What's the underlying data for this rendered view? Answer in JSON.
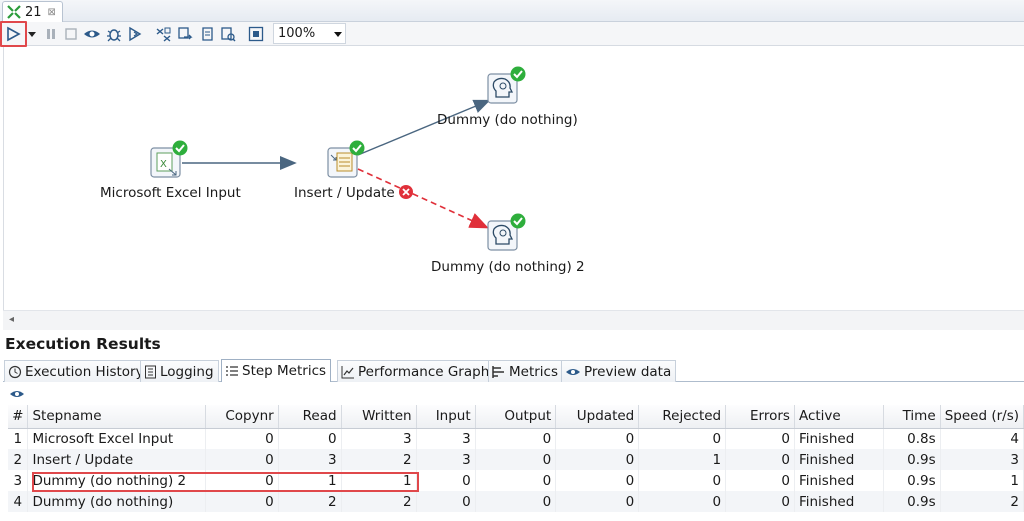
{
  "editor_tab": {
    "label": "21",
    "close": "⊠"
  },
  "toolbar": {
    "icons": [
      "run-icon",
      "dropdown-icon",
      "pause-icon",
      "stop-icon",
      "preview-icon",
      "debug-icon",
      "replay-icon",
      "verify-icon",
      "impact-icon",
      "sql-icon",
      "explore-db-icon",
      "align-icon"
    ],
    "zoom": "100%"
  },
  "canvas": {
    "steps": [
      {
        "id": "excel",
        "label": "Microsoft Excel Input"
      },
      {
        "id": "insert",
        "label": "Insert / Update"
      },
      {
        "id": "dummy1",
        "label": "Dummy (do nothing)"
      },
      {
        "id": "dummy2",
        "label": "Dummy (do nothing) 2"
      }
    ],
    "colors": {
      "ok": "#2eae3c",
      "error": "#e0303a",
      "hop": "#4a6680",
      "error_hop": "#e0303a"
    }
  },
  "results": {
    "title": "Execution Results",
    "tabs": [
      {
        "label": "Execution History",
        "icon": "history-icon"
      },
      {
        "label": "Logging",
        "icon": "log-icon"
      },
      {
        "label": "Step Metrics",
        "icon": "metrics-list-icon",
        "active": true
      },
      {
        "label": "Performance Graph",
        "icon": "graph-icon"
      },
      {
        "label": "Metrics",
        "icon": "metrics-icon"
      },
      {
        "label": "Preview data",
        "icon": "eye-icon"
      }
    ],
    "columns": [
      "#",
      "Stepname",
      "Copynr",
      "Read",
      "Written",
      "Input",
      "Output",
      "Updated",
      "Rejected",
      "Errors",
      "Active",
      "Time",
      "Speed (r/s)"
    ],
    "rows": [
      [
        "1",
        "Microsoft Excel Input",
        "0",
        "0",
        "3",
        "3",
        "0",
        "0",
        "0",
        "0",
        "Finished",
        "0.8s",
        "4"
      ],
      [
        "2",
        "Insert / Update",
        "0",
        "3",
        "2",
        "3",
        "0",
        "0",
        "1",
        "0",
        "Finished",
        "0.9s",
        "3"
      ],
      [
        "3",
        "Dummy (do nothing) 2",
        "0",
        "1",
        "1",
        "0",
        "0",
        "0",
        "0",
        "0",
        "Finished",
        "0.9s",
        "1"
      ],
      [
        "4",
        "Dummy (do nothing)",
        "0",
        "2",
        "2",
        "0",
        "0",
        "0",
        "0",
        "0",
        "Finished",
        "0.9s",
        "2"
      ]
    ]
  }
}
